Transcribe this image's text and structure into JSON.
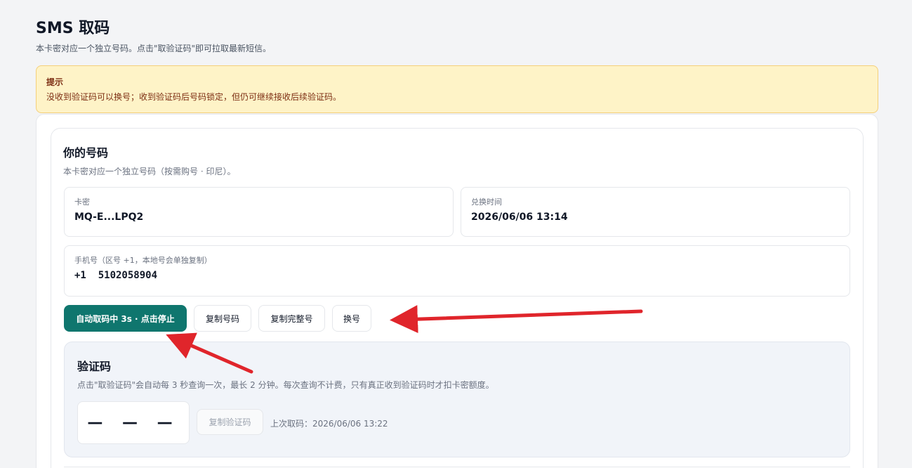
{
  "page": {
    "title": "SMS 取码",
    "subtitle": "本卡密对应一个独立号码。点击\"取验证码\"即可拉取最新短信。"
  },
  "notice": {
    "title": "提示",
    "text": "没收到验证码可以换号；收到验证码后号码锁定，但仍可继续接收后续验证码。"
  },
  "number_card": {
    "title": "你的号码",
    "desc": "本卡密对应一个独立号码（按需购号 · 印尼）。",
    "card_key_label": "卡密",
    "card_key_value": "MQ-E...LPQ2",
    "redeem_time_label": "兑换时间",
    "redeem_time_value": "2026/06/06 13:14",
    "phone_label": "手机号（区号 +1，本地号会单独复制）",
    "phone_value": "+1  5102058904"
  },
  "actions": {
    "auto_fetch": "自动取码中 3s · 点击停止",
    "copy_number": "复制号码",
    "copy_full": "复制完整号",
    "change_number": "换号"
  },
  "code_panel": {
    "title": "验证码",
    "desc": "点击\"取验证码\"会自动每 3 秒查询一次，最长 2 分钟。每次查询不计费，只有真正收到验证码时才扣卡密额度。",
    "code_placeholder": "— — —",
    "copy_code": "复制验证码",
    "last_fetch": "上次取码：2026/06/06 13:22"
  },
  "colors": {
    "primary": "#0f766e",
    "notice_bg": "#fef3c7",
    "annotation_arrow": "#e0252b"
  }
}
